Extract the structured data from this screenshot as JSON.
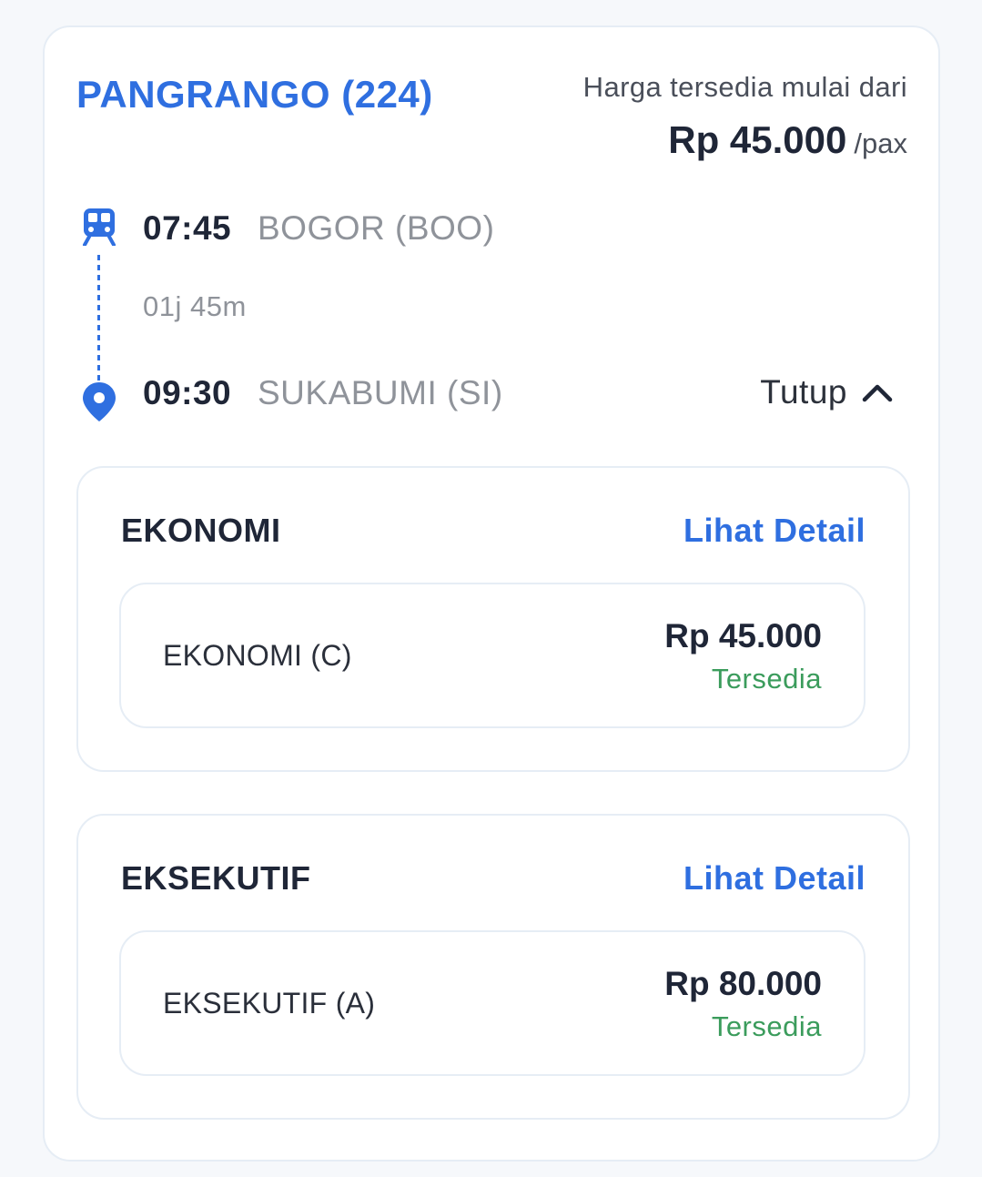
{
  "train": {
    "name": "PANGRANGO (224)",
    "price_caption": "Harga tersedia mulai dari",
    "price": "Rp 45.000",
    "price_unit": "/pax"
  },
  "route": {
    "departure": {
      "time": "07:45",
      "station": "BOGOR (BOO)"
    },
    "duration": "01j 45m",
    "arrival": {
      "time": "09:30",
      "station": "SUKABUMI (SI)"
    },
    "toggle_label": "Tutup"
  },
  "classes": [
    {
      "title": "EKONOMI",
      "detail_label": "Lihat Detail",
      "sub": {
        "name": "EKONOMI (C)",
        "price": "Rp 45.000",
        "status": "Tersedia"
      }
    },
    {
      "title": "EKSEKUTIF",
      "detail_label": "Lihat Detail",
      "sub": {
        "name": "EKSEKUTIF (A)",
        "price": "Rp 80.000",
        "status": "Tersedia"
      }
    }
  ],
  "colors": {
    "accent": "#2f6fe0",
    "available": "#3b9c5c",
    "text_dark": "#1f2637",
    "text_muted": "#8f939a",
    "border": "#e6edf5"
  },
  "icons": {
    "train": "train-icon",
    "pin": "location-pin-icon",
    "chevron": "chevron-up-icon"
  }
}
